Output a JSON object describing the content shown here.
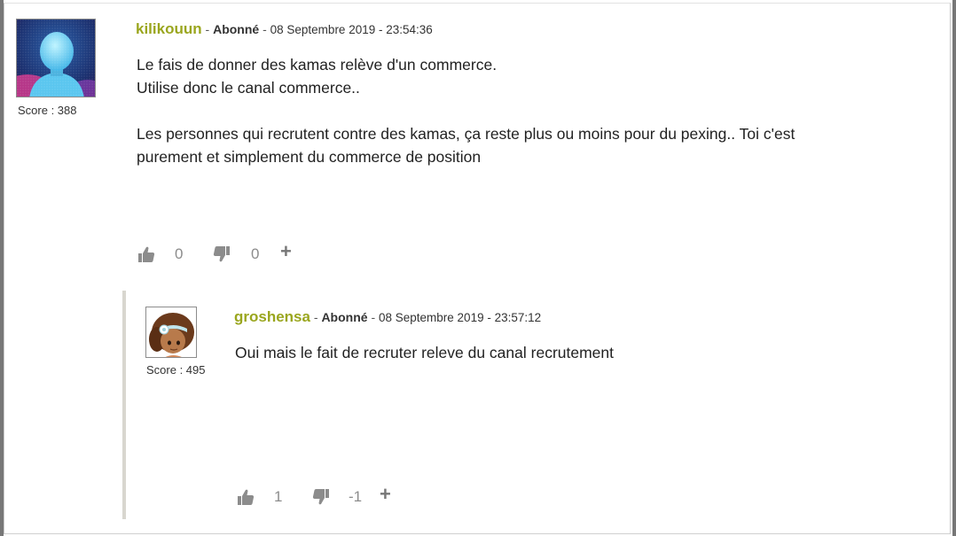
{
  "comments": [
    {
      "username": "kilikouun",
      "separator": "-",
      "role": "Abonné",
      "date": "08 Septembre 2019 - 23:54:36",
      "score": "Score : 388",
      "paragraphs": [
        "Le fais de donner des kamas relève d'un commerce.",
        "Utilise donc le canal commerce..",
        "",
        "Les personnes qui recrutent contre des kamas, ça reste plus ou moins pour du pexing.. Toi c'est",
        "purement et simplement du commerce de position"
      ],
      "likes": "0",
      "dislikes": "0",
      "plus": "+",
      "avatar_icon": "blue-silhouette-avatar"
    },
    {
      "username": "groshensa",
      "separator": "-",
      "role": "Abonné",
      "date": "08 Septembre 2019 - 23:57:12",
      "score": "Score : 495",
      "paragraphs": [
        "Oui mais le fait de recruter releve du canal recrutement"
      ],
      "likes": "1",
      "dislikes": "-1",
      "plus": "+",
      "avatar_icon": "character-portrait-avatar"
    }
  ],
  "colors": {
    "username": "#9aa61e",
    "action_icon": "#8c8c8c",
    "reply_bar": "#d8d6cf"
  },
  "icons": {
    "like": "thumbs-up-icon",
    "dislike": "thumbs-down-icon",
    "more": "plus-icon"
  }
}
